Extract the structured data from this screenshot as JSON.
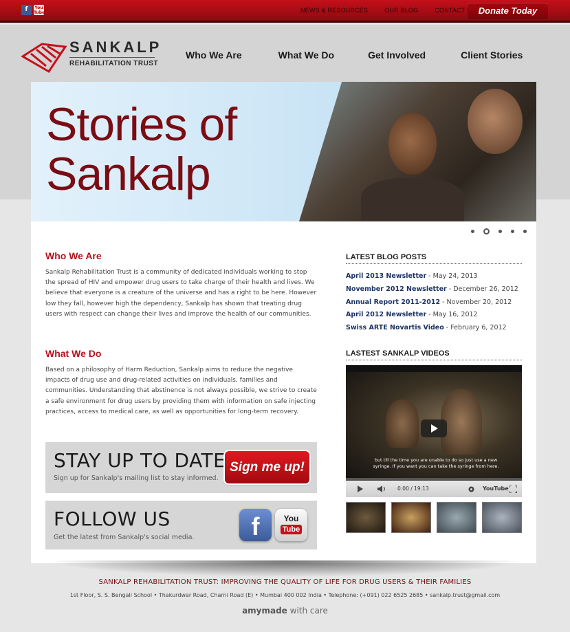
{
  "topbar": {
    "links": [
      "NEWS & RESOURCES",
      "OUR BLOG",
      "CONTACT US"
    ],
    "donate_label": "Donate Today",
    "facebook_icon": "f",
    "youtube_icon": "You Tube"
  },
  "logo": {
    "name": "SANKALP",
    "subtitle": "REHABILITATION TRUST"
  },
  "nav": [
    "Who We Are",
    "What We Do",
    "Get Involved",
    "Client Stories"
  ],
  "hero": {
    "title_line1": "Stories of",
    "title_line2": "Sankalp",
    "slide_count": 5,
    "active_slide": 2
  },
  "main": {
    "who_title": "Who We Are",
    "who_text": "Sankalp Rehabilitation Trust is a community of dedicated individuals working to stop the spread of HIV and empower drug users to take charge of their health and lives. We believe that everyone is a creature of the universe and has a right to be here. However low they fall, however high the dependency, Sankalp has shown that treating drug users with respect can change their lives and improve the health of our communities.",
    "what_title": "What We Do",
    "what_text": "Based on a philosophy of Harm Reduction, Sankalp aims to reduce the negative impacts of drug use and drug-related activities on individuals, families and communities. Understanding that abstinence is not always possible, we strive to create a safe environment for drug users by providing them with information on safe injecting practices, access to medical care, as well as opportunities for long-term recovery.",
    "stay_title": "STAY UP TO DATE",
    "stay_text": "Sign up for Sankalp's mailing list to stay informed.",
    "signup_label": "Sign me up!",
    "follow_title": "FOLLOW US",
    "follow_text": "Get the latest from Sankalp's social media.",
    "fb_letter": "f",
    "yt_you": "You",
    "yt_tube": "Tube"
  },
  "sidebar": {
    "blog_title": "LATEST BLOG POSTS",
    "posts": [
      {
        "title": "April 2013 Newsletter",
        "date": " - May 24, 2013"
      },
      {
        "title": "November 2012 Newsletter",
        "date": " - December 26, 2012"
      },
      {
        "title": "Annual Report 2011-2012",
        "date": " - November 20, 2012"
      },
      {
        "title": "April 2012 Newsletter",
        "date": " - May 16, 2012"
      },
      {
        "title": "Swiss ARTE Novartis Video",
        "date": " - February 6, 2012"
      }
    ],
    "videos_title": "LASTEST SANKALP VIDEOS",
    "video_subtitle": "but till the time you are unable to do so just use a new syringe. If you want you can take the syringe from here.",
    "video_time": "0:00 / 19:13",
    "video_brand": "YouTube",
    "thumb_count": 4
  },
  "footer": {
    "tagline": "SANKALP REHABILITATION TRUST: IMPROVING THE QUALITY OF LIFE FOR DRUG USERS & THEIR FAMILIES",
    "address": "1st Floor, S. S. Bengali School • Thakurdwar Road, Charni Road (E) • Mumbai 400 002 India • Telephone: (+091) 022 6525 2685 • sankalp.trust@gmail.com",
    "credit_brand": "amymade",
    "credit_suffix": " with care"
  },
  "colors": {
    "brand_red": "#b0131c",
    "topbar_red": "#c4101a",
    "link_navy": "#1c3366",
    "hero_title": "#7a0d14"
  }
}
